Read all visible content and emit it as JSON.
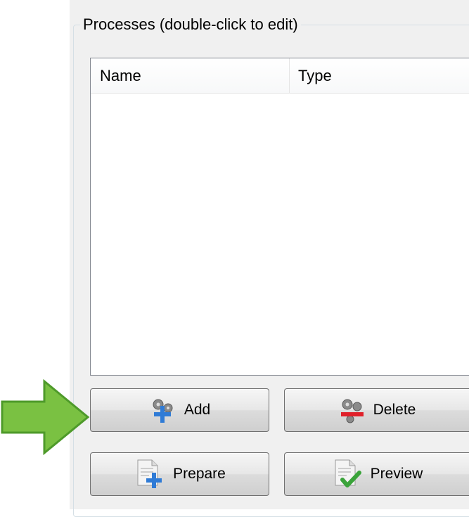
{
  "group": {
    "title": "Processes (double-click to edit)"
  },
  "list": {
    "columns": [
      "Name",
      "Type"
    ],
    "rows": []
  },
  "buttons": {
    "add": "Add",
    "delete": "Delete",
    "prepare": "Prepare",
    "preview": "Preview"
  },
  "icons": {
    "add": "gears-plus-icon",
    "delete": "gears-minus-icon",
    "prepare": "document-plus-icon",
    "preview": "document-check-icon",
    "pointer": "green-arrow-icon"
  },
  "colors": {
    "arrow": "#7ac142",
    "plus": "#2f7bd6",
    "minus": "#e0202a",
    "check": "#3aa33a"
  }
}
